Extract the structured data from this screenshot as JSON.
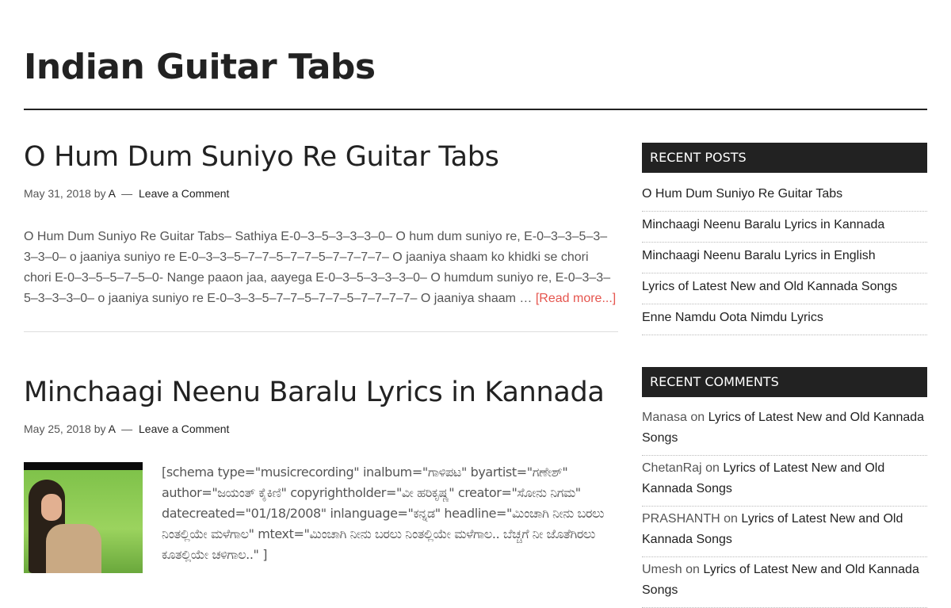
{
  "site": {
    "title": "Indian Guitar Tabs"
  },
  "posts": [
    {
      "title": "O Hum Dum Suniyo Re Guitar Tabs",
      "date": "May 31, 2018",
      "by": "by",
      "author": "A",
      "comment_link": "Leave a Comment",
      "excerpt": "O Hum Dum Suniyo Re Guitar Tabs– Sathiya E-0–3–5–3–3–3–0– O hum dum suniyo re, E-0–3–3–5–3–3–3–0– o jaaniya suniyo re E-0–3–3–5–7–7–5–7–7–5–7–7–7–7– O jaaniya shaam ko khidki se chori chori E-0–3–5–5–7–5–0- Nange paaon jaa, aayega E-0–3–5–3–3–3–0– O humdum suniyo re, E-0–3–3–5–3–3–3–0– o jaaniya suniyo re E-0–3–3–5–7–7–5–7–7–5–7–7–7–7– O jaaniya shaam …",
      "read_more": "[Read more...]"
    },
    {
      "title": "Minchaagi Neenu Baralu Lyrics in Kannada",
      "date": "May 25, 2018",
      "by": "by",
      "author": "A",
      "comment_link": "Leave a Comment",
      "excerpt": "[schema type=\"musicrecording\" inalbum=\"ಗಾಳಿಪಟ\" byartist=\"ಗಣೇಶ್\" author=\"ಜಯಂತ್ ಕೈಕಿಣಿ\" copyrightholder=\"ವೀ ಹರಿಕೃಷ್ಣ\" creator=\"ಸೋನು ನಿಗಮ\" datecreated=\"01/18/2008\" inlanguage=\"ಕನ್ನಡ\" headline=\"ಮಿಂಚಾಗಿ ನೀನು ಬರಲು ನಿಂತಲ್ಲಿಯೇ ಮಳೆಗಾಲ\" mtext=\"ಮಿಂಚಾಗಿ ನೀನು ಬರಲು ನಿಂತಲ್ಲಿಯೇ ಮಳೆಗಾಲ.. ಬೆಚ್ಚಗೆ ನೀ ಜೊತೆಗಿರಲು ಕೂತಲ್ಲಿಯೇ ಚಳಿಗಾಲ..\" ]"
    }
  ],
  "sidebar": {
    "recent_posts_title": "RECENT POSTS",
    "recent_posts": [
      "O Hum Dum Suniyo Re Guitar Tabs",
      "Minchaagi Neenu Baralu Lyrics in Kannada",
      "Minchaagi Neenu Baralu Lyrics in English",
      "Lyrics of Latest New and Old Kannada Songs",
      "Enne Namdu Oota Nimdu Lyrics"
    ],
    "recent_comments_title": "RECENT COMMENTS",
    "recent_comments": [
      {
        "author": "Manasa",
        "on": "on",
        "post": "Lyrics of Latest New and Old Kannada Songs"
      },
      {
        "author": "ChetanRaj",
        "on": "on",
        "post": "Lyrics of Latest New and Old Kannada Songs"
      },
      {
        "author": "PRASHANTH",
        "on": "on",
        "post": "Lyrics of Latest New and Old Kannada Songs"
      },
      {
        "author": "Umesh",
        "on": "on",
        "post": "Lyrics of Latest New and Old Kannada Songs"
      }
    ]
  }
}
